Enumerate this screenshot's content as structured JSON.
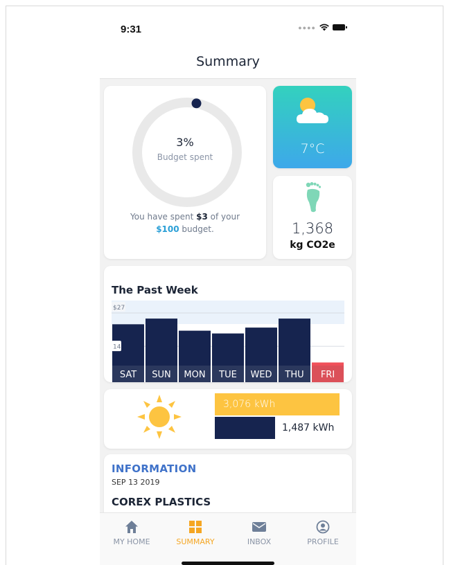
{
  "status_bar": {
    "time": "9:31"
  },
  "header": {
    "title": "Summary"
  },
  "budget": {
    "percent_text": "3%",
    "label": "Budget spent",
    "percent_value": 3,
    "spent_prefix": "You have spent ",
    "spent_amount": "$3",
    "spent_middle": " of your",
    "budget_amount": "$100",
    "spent_suffix": " budget.",
    "ring_color": "#e9e9e9",
    "dot_color": "#16244f"
  },
  "weather": {
    "temperature": "7°C",
    "icon": "partly-cloudy-icon"
  },
  "carbon": {
    "value": "1,368",
    "unit": "kg CO2e",
    "icon": "footprint-icon"
  },
  "past_week": {
    "title": "The Past Week",
    "y_top_label": "$27",
    "y_mid_label": "14"
  },
  "chart_data": {
    "type": "bar",
    "title": "The Past Week",
    "categories": [
      "SAT",
      "SUN",
      "MON",
      "TUE",
      "WED",
      "THU",
      "FRI"
    ],
    "values": [
      22.6,
      24.8,
      20.1,
      19.0,
      21.3,
      24.8,
      7.7
    ],
    "ylim": [
      0,
      27
    ],
    "y_ticks": [
      "$27",
      "14"
    ],
    "grid": true,
    "colors": {
      "bar": "#16244f",
      "today": "#f0505a",
      "label_band": "#2c3a5e"
    }
  },
  "energy": {
    "consumption_label": "3,076 kWh",
    "consumption_value": 3076,
    "production_label": "1,487 kWh",
    "production_value": 1487,
    "icon": "sun-icon",
    "colors": {
      "consumption": "#fdc441",
      "production": "#16244f"
    }
  },
  "information": {
    "heading": "INFORMATION",
    "date": "SEP 13 2019",
    "company": "COREX PLASTICS"
  },
  "tabs": [
    {
      "label": "MY HOME",
      "icon": "home-icon",
      "active": false
    },
    {
      "label": "SUMMARY",
      "icon": "grid-icon",
      "active": true
    },
    {
      "label": "INBOX",
      "icon": "mail-icon",
      "active": false
    },
    {
      "label": "PROFILE",
      "icon": "profile-icon",
      "active": false
    }
  ]
}
